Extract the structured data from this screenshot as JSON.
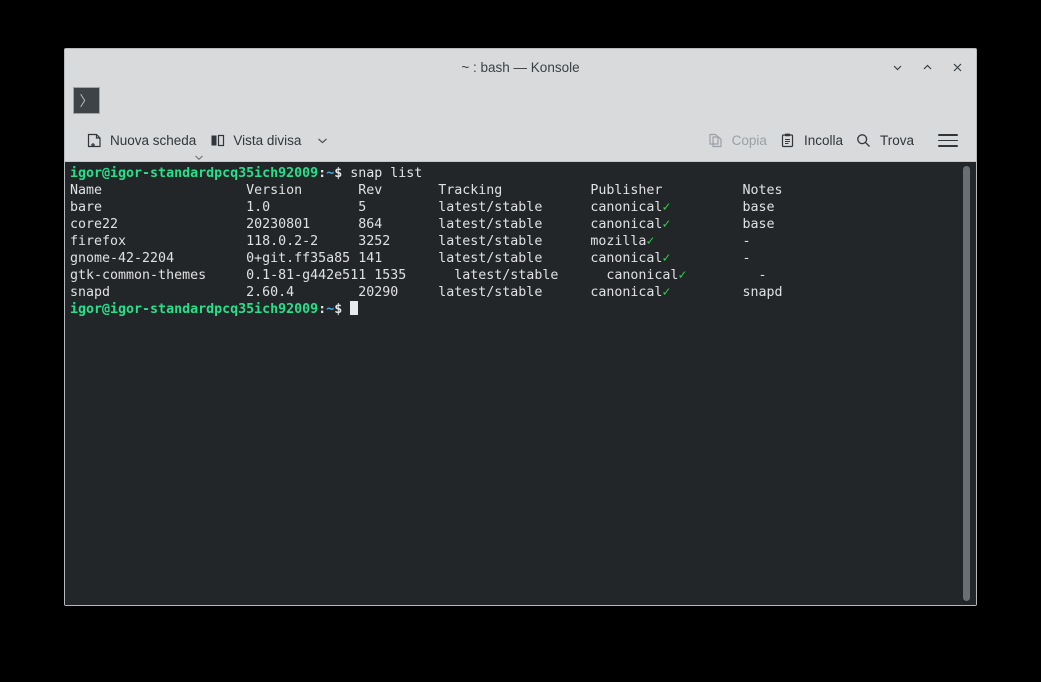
{
  "window": {
    "title": "~ : bash — Konsole",
    "controls": [
      {
        "name": "minimize",
        "icon": "chevron-down-icon"
      },
      {
        "name": "maximize",
        "icon": "chevron-up-icon"
      },
      {
        "name": "close",
        "icon": "close-icon"
      }
    ]
  },
  "tabstrip": {
    "tab_glyph": "〉"
  },
  "toolbar": {
    "new_tab_label": "Nuova scheda",
    "split_view_label": "Vista divisa",
    "copy_label": "Copia",
    "paste_label": "Incolla",
    "find_label": "Trova",
    "menu_label": "hamburger-menu"
  },
  "terminal": {
    "prompt": {
      "user_host": "igor@igor-standardpcq35ich92009",
      "colon": ":",
      "path": "~",
      "dollar": "$"
    },
    "command": "snap list",
    "table": {
      "headers": [
        "Name",
        "Version",
        "Rev",
        "Tracking",
        "Publisher",
        "Notes"
      ],
      "rows": [
        {
          "name": "bare",
          "version": "1.0",
          "rev": "5",
          "tracking": "latest/stable",
          "publisher": "canonical",
          "verified": true,
          "notes": "base"
        },
        {
          "name": "core22",
          "version": "20230801",
          "rev": "864",
          "tracking": "latest/stable",
          "publisher": "canonical",
          "verified": true,
          "notes": "base"
        },
        {
          "name": "firefox",
          "version": "118.0.2-2",
          "rev": "3252",
          "tracking": "latest/stable",
          "publisher": "mozilla",
          "verified": true,
          "notes": "-"
        },
        {
          "name": "gnome-42-2204",
          "version": "0+git.ff35a85",
          "rev": "141",
          "tracking": "latest/stable",
          "publisher": "canonical",
          "verified": true,
          "notes": "-"
        },
        {
          "name": "gtk-common-themes",
          "version": "0.1-81-g442e511",
          "rev": "1535",
          "tracking": "latest/stable",
          "publisher": "canonical",
          "verified": true,
          "notes": "-"
        },
        {
          "name": "snapd",
          "version": "2.60.4",
          "rev": "20290",
          "tracking": "latest/stable",
          "publisher": "canonical",
          "verified": true,
          "notes": "snapd"
        }
      ]
    },
    "colors": {
      "background": "#232629",
      "foreground": "#e3e5e7",
      "prompt_user": "#27e08a",
      "prompt_path": "#3daee9",
      "verified_check": "#2bd24b"
    }
  }
}
